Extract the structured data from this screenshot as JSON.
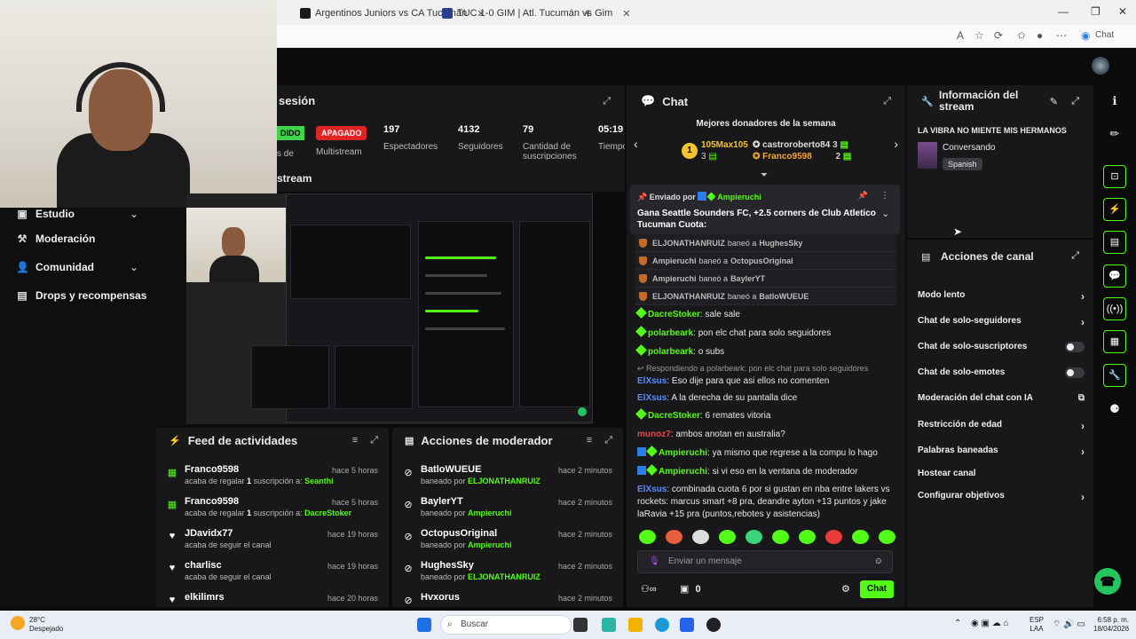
{
  "browser": {
    "tabs": [
      {
        "label": "Argentinos Juniors vs CA Tucumán"
      },
      {
        "label": "TUC 1-0 GIM | Atl. Tucumán vs Gim"
      }
    ],
    "chat_label": "Chat"
  },
  "nav": {
    "items": [
      {
        "label": "Estudio"
      },
      {
        "label": "Moderación"
      },
      {
        "label": "Comunidad"
      },
      {
        "label": "Drops y recompensas"
      }
    ]
  },
  "session": {
    "title": "sesión",
    "online_badge": "DIDO",
    "multistream_badge": "APAGADO",
    "multistream_label": "Multistream",
    "stats": [
      {
        "value": "197",
        "label": "Espectadores"
      },
      {
        "value": "4132",
        "label": "Seguidores"
      },
      {
        "value": "79",
        "label": "Cantidad de suscripciones"
      },
      {
        "value": "05:19",
        "label": "Tiempo"
      }
    ],
    "stats_partial_label": "s de",
    "stream_label": "stream"
  },
  "feed": {
    "title": "Feed de actividades",
    "items": [
      {
        "name": "Franco9598",
        "text": "acaba de regalar ",
        "count": "1",
        "text2": " suscripción a: ",
        "target": "Seanthi",
        "time": "hace 5 horas",
        "icon": "gift-icon"
      },
      {
        "name": "Franco9598",
        "text": "acaba de regalar ",
        "count": "1",
        "text2": " suscripción a: ",
        "target": "DacreStoker",
        "time": "hace 5 horas",
        "icon": "gift-icon"
      },
      {
        "name": "JDavidx77",
        "text": "acaba de seguir el canal",
        "time": "hace 19 horas",
        "icon": "heart-icon"
      },
      {
        "name": "charlisc",
        "text": "acaba de seguir el canal",
        "time": "hace 19 horas",
        "icon": "heart-icon"
      },
      {
        "name": "elkilimrs",
        "text": "",
        "time": "hace 20 horas",
        "icon": "heart-icon"
      }
    ]
  },
  "modactions": {
    "title": "Acciones de moderador",
    "items": [
      {
        "name": "BatloWUEUE",
        "by": "ELJONATHANRUIZ",
        "time": "hace 2 minutos"
      },
      {
        "name": "BaylerYT",
        "by": "Ampieruchi",
        "time": "hace 2 minutos"
      },
      {
        "name": "OctopusOriginal",
        "by": "Ampieruchi",
        "time": "hace 2 minutos"
      },
      {
        "name": "HughesSky",
        "by": "ELJONATHANRUIZ",
        "time": "hace 2 minutos"
      },
      {
        "name": "Hvxorus",
        "by": "",
        "time": "hace 2 minutos"
      }
    ],
    "banned_by": "baneado por "
  },
  "chat": {
    "title": "Chat",
    "donors_title": "Mejores donadores de la semana",
    "donors": [
      {
        "name": "105Max105",
        "amount": "3"
      },
      {
        "name": "castroroberto84",
        "amount": "3"
      },
      {
        "name": "Franco9598",
        "amount": "2"
      }
    ],
    "pinned": {
      "sent_by": "Enviado por ",
      "user": "Ampieruchi",
      "text": "Gana Seattle Sounders FC, +2.5 corners de Club Atletico Tucuman Cuota:"
    },
    "bans": [
      {
        "mod": "ELJONATHANRUIZ",
        "action": " baneó a ",
        "user": "HughesSky"
      },
      {
        "mod": "Ampieruchi",
        "action": " baneó a ",
        "user": "OctopusOriginal"
      },
      {
        "mod": "Ampieruchi",
        "action": " baneó a ",
        "user": "BaylerYT"
      },
      {
        "mod": "ELJONATHANRUIZ",
        "action": " baneó a ",
        "user": "BatloWUEUE"
      }
    ],
    "messages": [
      {
        "user": "DacreStoker",
        "text": ": sale sale",
        "color": "#53fc18"
      },
      {
        "user": "polarbeark",
        "text": ": pon elc chat para solo seguidores",
        "color": "#53fc18"
      },
      {
        "user": "polarbeark",
        "text": ": o subs",
        "color": "#53fc18"
      },
      {
        "user": "ElXsus",
        "text": ": Eso dije para que asi ellos no comenten",
        "color": "#5b8cff",
        "reply": "Respondiendo a polarbeark: pon elc chat para solo seguidores"
      },
      {
        "user": "ElXsus",
        "text": ": A la derecha de su pantalla dice",
        "color": "#5b8cff"
      },
      {
        "user": "DacreStoker",
        "text": ": 6 remates vitoria",
        "color": "#53fc18"
      },
      {
        "user": "munoz7",
        "text": ": ambos anotan en australia?",
        "color": "#e5484d"
      },
      {
        "user": "Ampieruchi",
        "text": ": ya mismo que regrese a la compu lo hago",
        "color": "#53fc18"
      },
      {
        "user": "Ampieruchi",
        "text": ": si vi eso en la ventana de moderador",
        "color": "#53fc18"
      },
      {
        "user": "ElXsus",
        "text": ": combinada cuota 6 por si gustan en nba entre lakers vs rockets: marcus smart +8 pra, deandre ayton +13 puntos y jake laRavia +15 pra (puntos,rebotes y asistencias)",
        "color": "#5b8cff"
      }
    ],
    "input_placeholder": "Enviar un mensaje",
    "points": "0",
    "send_label": "Chat"
  },
  "info": {
    "title": "Información del stream",
    "stream_title": "LA VIBRA NO MIENTE MIS HERMANOS",
    "category": "Conversando",
    "language": "Spanish"
  },
  "channel_actions": {
    "title": "Acciones de canal",
    "items": [
      {
        "label": "Modo lento",
        "control": "chevron"
      },
      {
        "label": "Chat de solo-seguidores",
        "control": "chevron"
      },
      {
        "label": "Chat de solo-suscriptores",
        "control": "toggle"
      },
      {
        "label": "Chat de solo-emotes",
        "control": "toggle"
      },
      {
        "label": "Moderación del chat con IA",
        "control": "external"
      },
      {
        "label": "Restricción de edad",
        "control": "chevron"
      },
      {
        "label": "Palabras baneadas",
        "control": "chevron"
      },
      {
        "label": "Hostear canal",
        "control": "none"
      },
      {
        "label": "Configurar objetivos",
        "control": "chevron"
      }
    ]
  },
  "taskbar": {
    "weather_temp": "28°C",
    "weather_text": "Despejado",
    "search_placeholder": "Buscar",
    "lang": "ESP",
    "lang2": "LAA",
    "time": "6:58 p. m.",
    "date": "18/04/2026"
  }
}
